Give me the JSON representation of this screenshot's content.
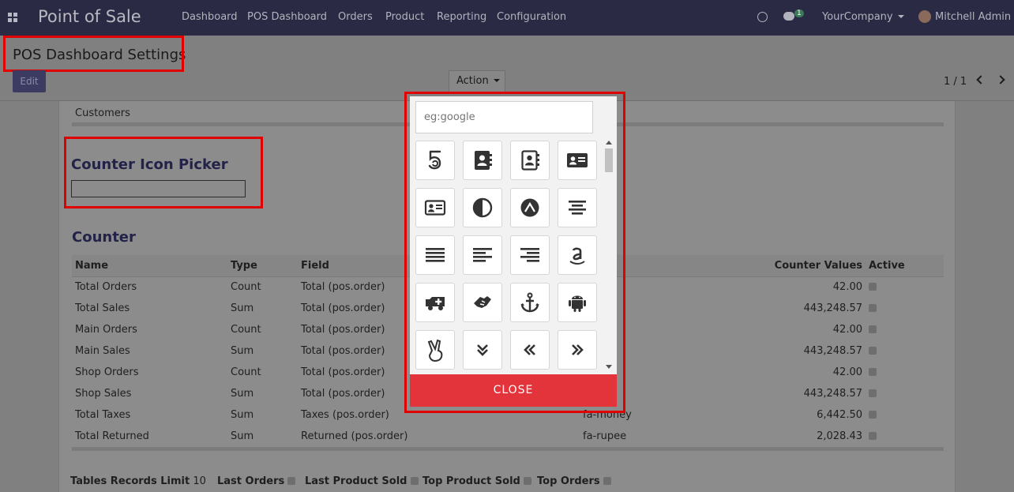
{
  "nav": {
    "app_name": "Point of Sale",
    "items": [
      "Dashboard",
      "POS Dashboard",
      "Orders",
      "Product",
      "Reporting",
      "Configuration"
    ],
    "chat_count": "1",
    "company": "YourCompany",
    "user": "Mitchell Admin"
  },
  "control": {
    "title": "POS Dashboard Settings",
    "edit_label": "Edit",
    "action_label": "Action",
    "pager": "1 / 1"
  },
  "form": {
    "customers_label": "Customers",
    "picker_title": "Counter Icon Picker",
    "counter_title": "Counter",
    "columns": [
      "Name",
      "Type",
      "Field",
      "",
      "Counter Values",
      "Active"
    ],
    "rows": [
      {
        "name": "Total Orders",
        "type": "Count",
        "field": "Total (pos.order)",
        "icon": "",
        "value": "42.00"
      },
      {
        "name": "Total Sales",
        "type": "Sum",
        "field": "Total (pos.order)",
        "icon": "",
        "value": "443,248.57"
      },
      {
        "name": "Main Orders",
        "type": "Count",
        "field": "Total (pos.order)",
        "icon": "",
        "value": "42.00"
      },
      {
        "name": "Main Sales",
        "type": "Sum",
        "field": "Total (pos.order)",
        "icon": "",
        "value": "443,248.57"
      },
      {
        "name": "Shop Orders",
        "type": "Count",
        "field": "Total (pos.order)",
        "icon": "",
        "value": "42.00"
      },
      {
        "name": "Shop Sales",
        "type": "Sum",
        "field": "Total (pos.order)",
        "icon": "",
        "value": "443,248.57"
      },
      {
        "name": "Total Taxes",
        "type": "Sum",
        "field": "Taxes (pos.order)",
        "icon": "fa-money",
        "value": "6,442.50"
      },
      {
        "name": "Total Returned",
        "type": "Sum",
        "field": "Returned (pos.order)",
        "icon": "fa-rupee",
        "value": "2,028.43"
      }
    ],
    "footer": {
      "tables_limit_label": "Tables Records Limit",
      "tables_limit_value": "10",
      "last_orders": "Last Orders",
      "last_product_sold": "Last Product Sold",
      "top_product_sold": "Top Product Sold",
      "top_orders": "Top Orders"
    }
  },
  "modal": {
    "search_placeholder": "eg:google",
    "close_label": "CLOSE",
    "icons": [
      "500px-icon",
      "address-book-icon",
      "address-book-o-icon",
      "address-card-icon",
      "address-card-o-icon",
      "adjust-icon",
      "adn-icon",
      "align-center-icon",
      "align-justify-icon",
      "align-left-icon",
      "align-right-icon",
      "amazon-icon",
      "ambulance-icon",
      "sign-language-icon",
      "anchor-icon",
      "android-icon",
      "hand-peace-icon",
      "angle-double-down-icon",
      "angle-double-left-icon",
      "angle-double-right-icon"
    ]
  }
}
